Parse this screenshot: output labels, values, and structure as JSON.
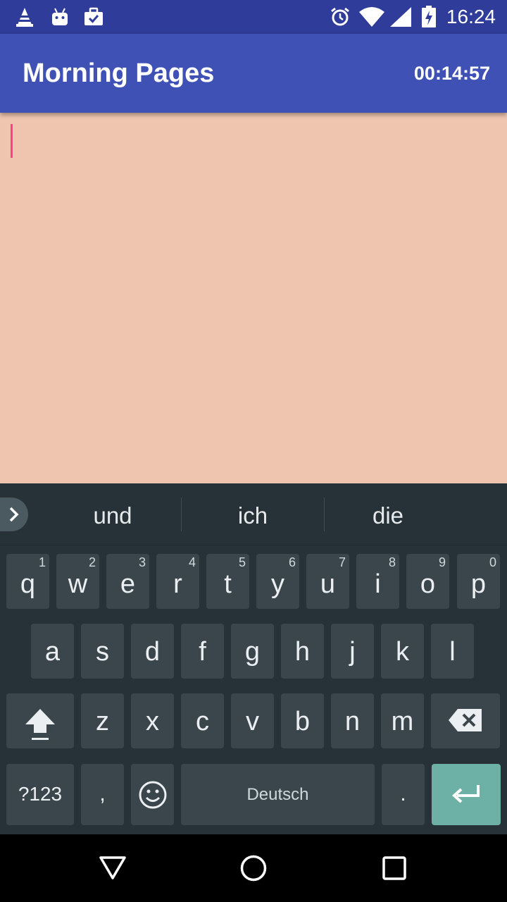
{
  "status_bar": {
    "time": "16:24",
    "left_icons": [
      "vlc-cone-icon",
      "android-icon",
      "briefcase-check-icon"
    ],
    "right_icons": [
      "alarm-icon",
      "wifi-icon",
      "signal-icon",
      "battery-charging-icon"
    ],
    "background": "#2f3c99"
  },
  "app_bar": {
    "title": "Morning Pages",
    "timer": "00:14:57",
    "background": "#3f51b5"
  },
  "editor": {
    "text": "",
    "background": "#efc5af",
    "cursor_color": "#ff4081"
  },
  "keyboard": {
    "suggestions": [
      "und",
      "ich",
      "die"
    ],
    "row1": [
      {
        "letter": "q",
        "hint": "1"
      },
      {
        "letter": "w",
        "hint": "2"
      },
      {
        "letter": "e",
        "hint": "3"
      },
      {
        "letter": "r",
        "hint": "4"
      },
      {
        "letter": "t",
        "hint": "5"
      },
      {
        "letter": "y",
        "hint": "6"
      },
      {
        "letter": "u",
        "hint": "7"
      },
      {
        "letter": "i",
        "hint": "8"
      },
      {
        "letter": "o",
        "hint": "9"
      },
      {
        "letter": "p",
        "hint": "0"
      }
    ],
    "row2": [
      "a",
      "s",
      "d",
      "f",
      "g",
      "h",
      "j",
      "k",
      "l"
    ],
    "row3": [
      "z",
      "x",
      "c",
      "v",
      "b",
      "n",
      "m"
    ],
    "symbols_label": "?123",
    "comma": ",",
    "space_label": "Deutsch",
    "period": ".",
    "enter_color": "#6cb0a6"
  },
  "nav_bar": {
    "buttons": [
      "back-triangle-icon",
      "home-circle-icon",
      "recents-square-icon"
    ]
  }
}
